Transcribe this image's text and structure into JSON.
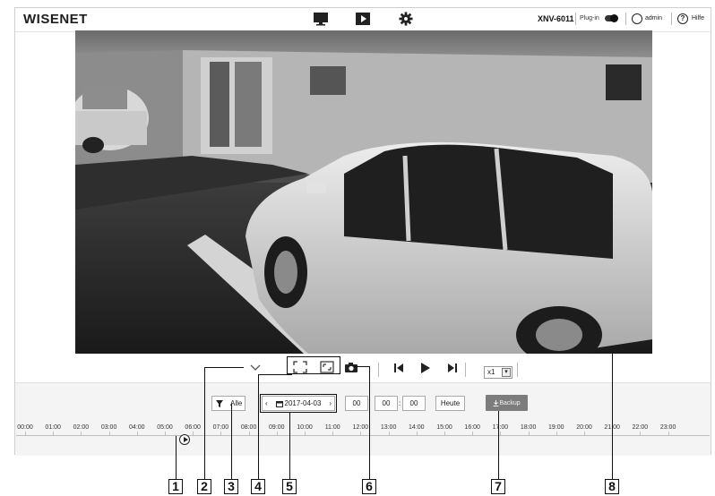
{
  "app": {
    "logo": "WISENET",
    "model": "XNV-6011",
    "plugin_label": "Plug-in",
    "user": "admin",
    "help": "Hilfe"
  },
  "nav": {
    "icons": [
      "monitor-icon",
      "play-icon",
      "gear-icon"
    ]
  },
  "toolbar": {
    "speed": "x1",
    "icons": [
      "chevron-down-icon",
      "fullscreen-icon",
      "fit-screen-icon",
      "camera-icon",
      "skip-back-icon",
      "play-icon",
      "skip-forward-icon"
    ]
  },
  "controls": {
    "filter_label": "Alle",
    "date": "2017-04-03",
    "hour": "00",
    "minute": "00",
    "second": "00",
    "today": "Heute",
    "backup": "Backup"
  },
  "timeline": {
    "labels": [
      "00:00",
      "01:00",
      "02:00",
      "03:00",
      "04:00",
      "05:00",
      "06:00",
      "07:00",
      "08:00",
      "09:00",
      "10:00",
      "11:00",
      "12:00",
      "13:00",
      "14:00",
      "15:00",
      "16:00",
      "17:00",
      "18:00",
      "19:00",
      "20:00",
      "21:00",
      "22:00",
      "23:00"
    ]
  },
  "callouts": [
    "1",
    "2",
    "3",
    "4",
    "5",
    "6",
    "7",
    "8"
  ]
}
